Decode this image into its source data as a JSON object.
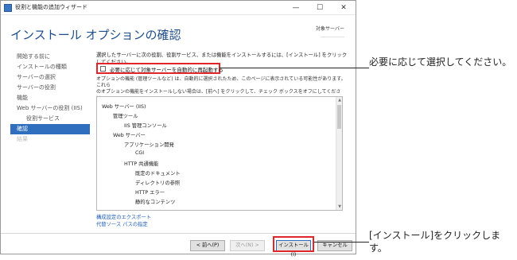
{
  "window": {
    "title": "役割と機能の追加ウィザード",
    "controls": {
      "min": "—",
      "max": "☐",
      "close": "✕"
    }
  },
  "header": {
    "page_title": "インストール オプションの確認",
    "destination_label": "対象サーバー",
    "destination_value": "……………"
  },
  "nav": {
    "items": [
      {
        "label": "開始する前に",
        "indent": false,
        "state": "normal"
      },
      {
        "label": "インストールの種類",
        "indent": false,
        "state": "normal"
      },
      {
        "label": "サーバーの選択",
        "indent": false,
        "state": "normal"
      },
      {
        "label": "サーバーの役割",
        "indent": false,
        "state": "normal"
      },
      {
        "label": "機能",
        "indent": false,
        "state": "normal"
      },
      {
        "label": "Web サーバーの役割 (IIS)",
        "indent": false,
        "state": "normal"
      },
      {
        "label": "役割サービス",
        "indent": true,
        "state": "normal"
      },
      {
        "label": "確認",
        "indent": false,
        "state": "active"
      },
      {
        "label": "結果",
        "indent": false,
        "state": "disabled"
      }
    ]
  },
  "content": {
    "description": "選択したサーバーに次の役割、役割サービス、または機能をインストールするには、[インストール] をクリックしてください。",
    "restart_checkbox_label": "必要に応じて対象サーバーを自動的に再起動する",
    "restart_checked": false,
    "note_line1": "オプションの機能 (管理ツールなど) は、自動的に選択されたため、このページに表示されている可能性があります。これら",
    "note_line2": "のオプションの機能をインストールしない場合は、[前へ] をクリックして、チェック ボックスをオフにしてください。",
    "features": [
      {
        "label": "Web サーバー (IIS)",
        "level": 0
      },
      {
        "label": "管理ツール",
        "level": 1
      },
      {
        "label": "IIS 管理コンソール",
        "level": 2
      },
      {
        "label": "Web サーバー",
        "level": 1
      },
      {
        "label": "アプリケーション開発",
        "level": 2
      },
      {
        "label": "CGI",
        "level": 3
      },
      {
        "label": "HTTP 共通機能",
        "level": 2
      },
      {
        "label": "既定のドキュメント",
        "level": 3
      },
      {
        "label": "ディレクトリの参照",
        "level": 3
      },
      {
        "label": "HTTP エラー",
        "level": 3
      },
      {
        "label": "静的なコンテンツ",
        "level": 3
      }
    ],
    "links": {
      "export": "構成設定のエクスポート",
      "alt_source": "代替ソース パスの指定"
    }
  },
  "footer": {
    "prev": "< 前へ(P)",
    "next": "次へ(N) >",
    "install": "インストール(I)",
    "cancel": "キャンセル"
  },
  "callouts": {
    "checkbox_note": "必要に応じて選択してください。",
    "install_note": "[インストール]をクリックします。"
  },
  "colors": {
    "accent": "#2f6fbd",
    "highlight": "#e0262b",
    "title": "#1f4e8c"
  }
}
